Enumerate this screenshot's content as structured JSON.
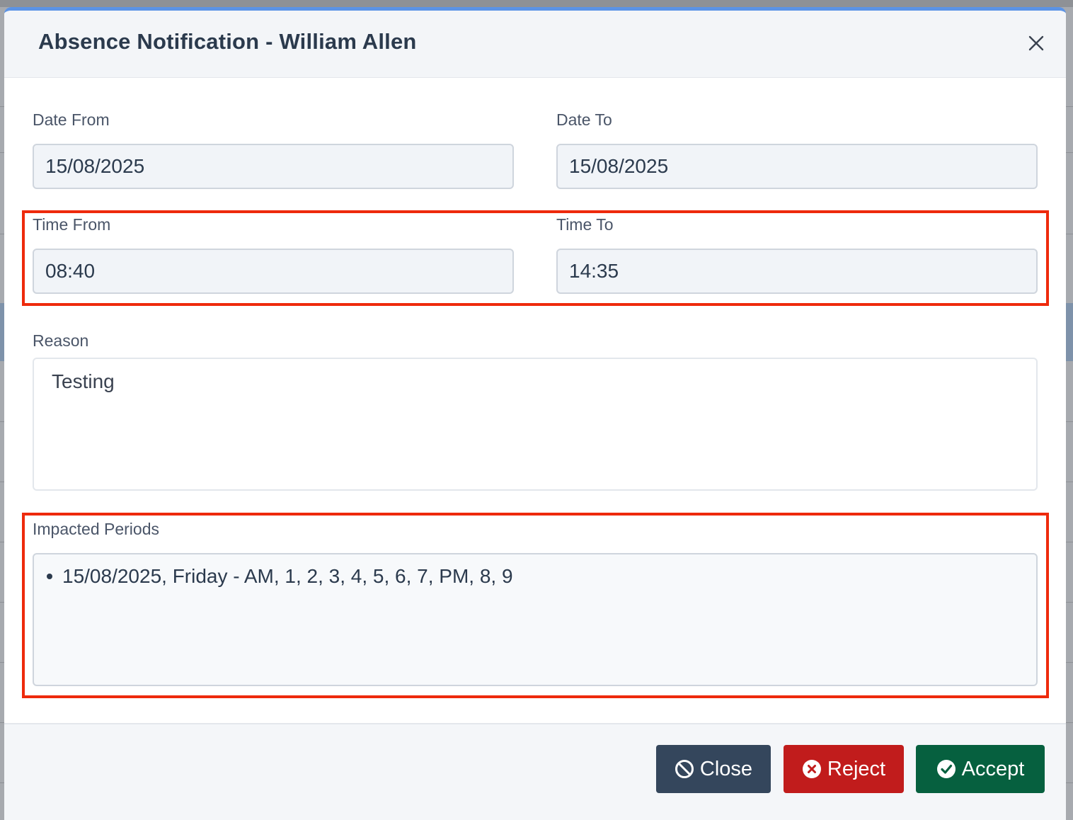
{
  "modal": {
    "title": "Absence Notification - William Allen",
    "accent_color": "#5b93e6"
  },
  "fields": {
    "date_from": {
      "label": "Date From",
      "value": "15/08/2025"
    },
    "date_to": {
      "label": "Date To",
      "value": "15/08/2025"
    },
    "time_from": {
      "label": "Time From",
      "value": "08:40"
    },
    "time_to": {
      "label": "Time To",
      "value": "14:35"
    },
    "reason": {
      "label": "Reason",
      "value": "Testing"
    },
    "impacted_periods": {
      "label": "Impacted Periods",
      "items": [
        "15/08/2025, Friday - AM, 1, 2, 3, 4, 5, 6, 7, PM, 8, 9"
      ]
    }
  },
  "highlight_color": "#ee2a0c",
  "footer": {
    "close_label": "Close",
    "reject_label": "Reject",
    "accept_label": "Accept",
    "close_color": "#34465c",
    "reject_color": "#c11c1c",
    "accept_color": "#06603f"
  },
  "icons": {
    "header_close": "close-icon",
    "close_button": "ban-icon",
    "reject_button": "times-circle-icon",
    "accept_button": "check-circle-icon"
  }
}
